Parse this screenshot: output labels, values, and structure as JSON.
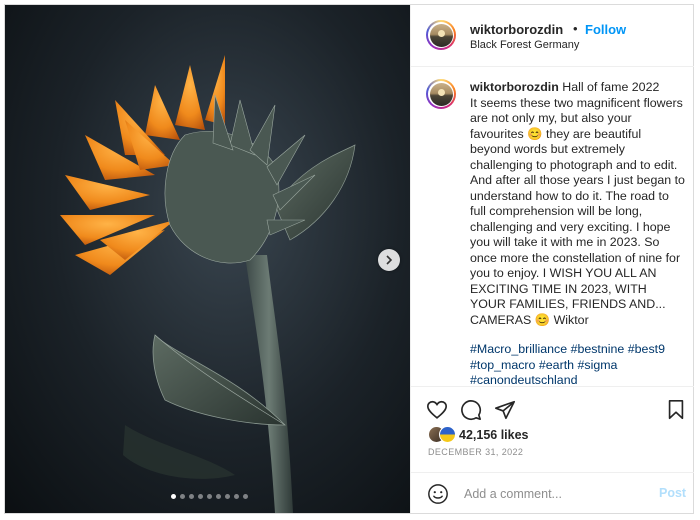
{
  "post": {
    "username": "wiktorborozdin",
    "separator": "•",
    "follow_label": "Follow",
    "location": "Black Forest Germany",
    "caption_username": "wiktorborozdin",
    "caption_text": " Hall of fame 2022\nIt seems these two magnificent flowers are not only my, but also your favourites 😊 they are beautiful beyond words but extremely challenging to photograph and to edit. And after all those years I just began to understand how to do it. The road to full comprehension will be long, challenging and very exciting. I hope you will take it with me in 2023. So once more the constellation of nine for you to enjoy. I WISH YOU ALL AN EXCITING TIME IN 2023, WITH YOUR FAMILIES, FRIENDS AND... CAMERAS 😊 Wiktor",
    "hashtags": [
      "#Macro_brilliance",
      "#bestnine",
      "#best9",
      "#top_macro",
      "#earth",
      "#sigma",
      "#canondeutschland"
    ],
    "likes": "42,156 likes",
    "date": "DECEMBER 31, 2022",
    "comment_placeholder": "Add a comment...",
    "post_label": "Post",
    "carousel_total": 9,
    "carousel_active": 1
  },
  "icons": {
    "like": "heart-icon",
    "comment": "comment-icon",
    "share": "paper-plane-icon",
    "save": "bookmark-icon",
    "emoji": "emoji-icon",
    "next": "chevron-right-icon"
  },
  "colors": {
    "follow": "#0095f6",
    "post_disabled": "#b2dffc",
    "hashtag": "#00376b",
    "petal": "#f08a1c"
  }
}
